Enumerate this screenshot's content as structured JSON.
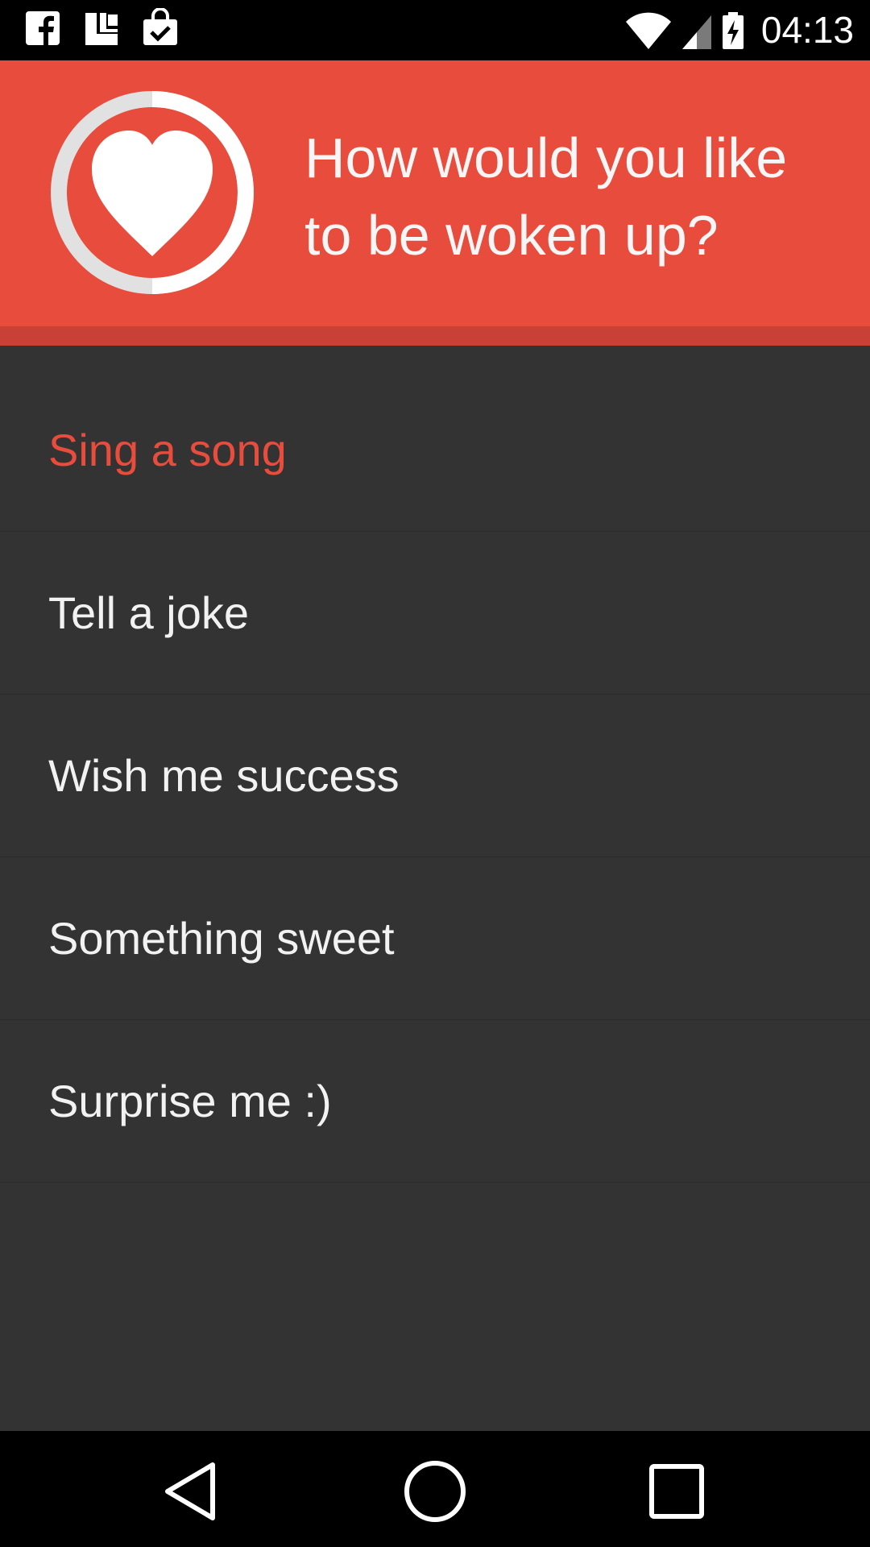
{
  "status_bar": {
    "time": "04:13",
    "left_icons": [
      "facebook-icon",
      "ledger-app-icon",
      "play-store-icon"
    ],
    "right_icons": [
      "wifi-icon",
      "cell-signal-icon",
      "battery-charging-icon"
    ]
  },
  "header": {
    "question": "How would you like to be woken up?",
    "icon": "heart-icon",
    "accent_color": "#e74c3c"
  },
  "options": [
    {
      "label": "Sing a song",
      "selected": true
    },
    {
      "label": "Tell a joke",
      "selected": false
    },
    {
      "label": "Wish me success",
      "selected": false
    },
    {
      "label": "Something sweet",
      "selected": false
    },
    {
      "label": "Surprise me :)",
      "selected": false
    }
  ],
  "nav_bar": {
    "buttons": [
      "back-icon",
      "home-icon",
      "recents-icon"
    ]
  }
}
